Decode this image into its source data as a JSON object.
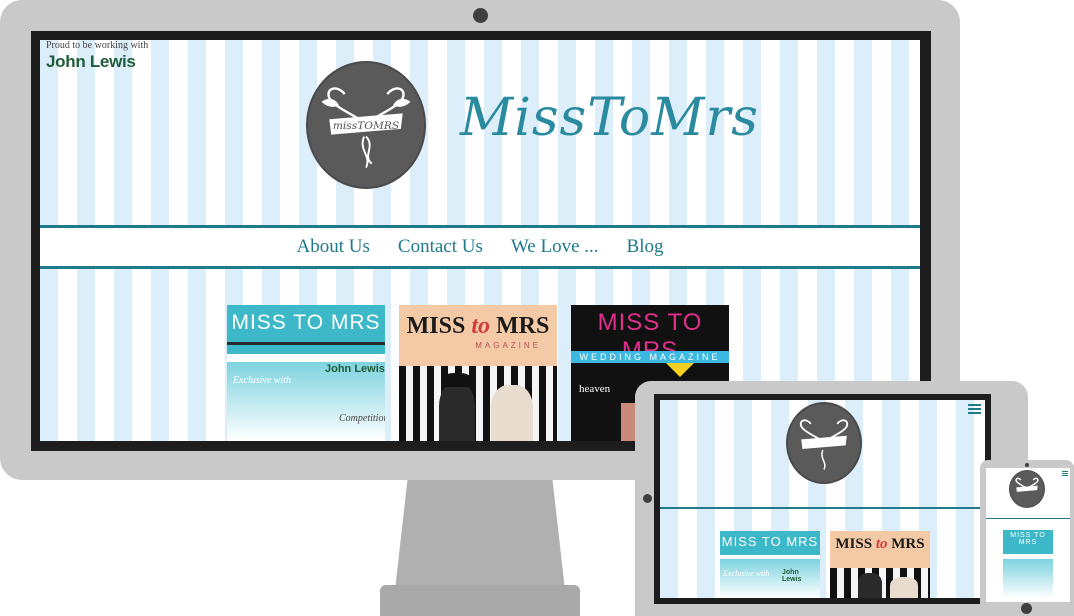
{
  "site": {
    "title": "MissToMrs",
    "logo_text": "missTOMRS",
    "partner": {
      "intro": "Proud to be working with",
      "name": "John Lewis"
    },
    "nav": [
      "About Us",
      "Contact Us",
      "We Love ...",
      "Blog"
    ]
  },
  "covers": {
    "cover1": {
      "title": "MISS TO MRS",
      "exclusive": "Exclusive with",
      "partner": "John Lewis",
      "competition": "Competition"
    },
    "cover2": {
      "title_a": "MISS",
      "title_b": "to",
      "title_c": "MRS",
      "subtitle": "MAGAZINE"
    },
    "cover3": {
      "title": "MISS TO MRS",
      "subtitle": "WEDDING MAGAZINE",
      "feature": "heaven"
    }
  },
  "colors": {
    "accent": "#1f7a8c",
    "title": "#2a8aa0",
    "stripe": "#ddeefb",
    "logo_circle": "#5a5a5a",
    "device_frame": "#c9c9c9"
  },
  "icons": [
    "menu-icon",
    "bird-icon",
    "heart-icon"
  ]
}
